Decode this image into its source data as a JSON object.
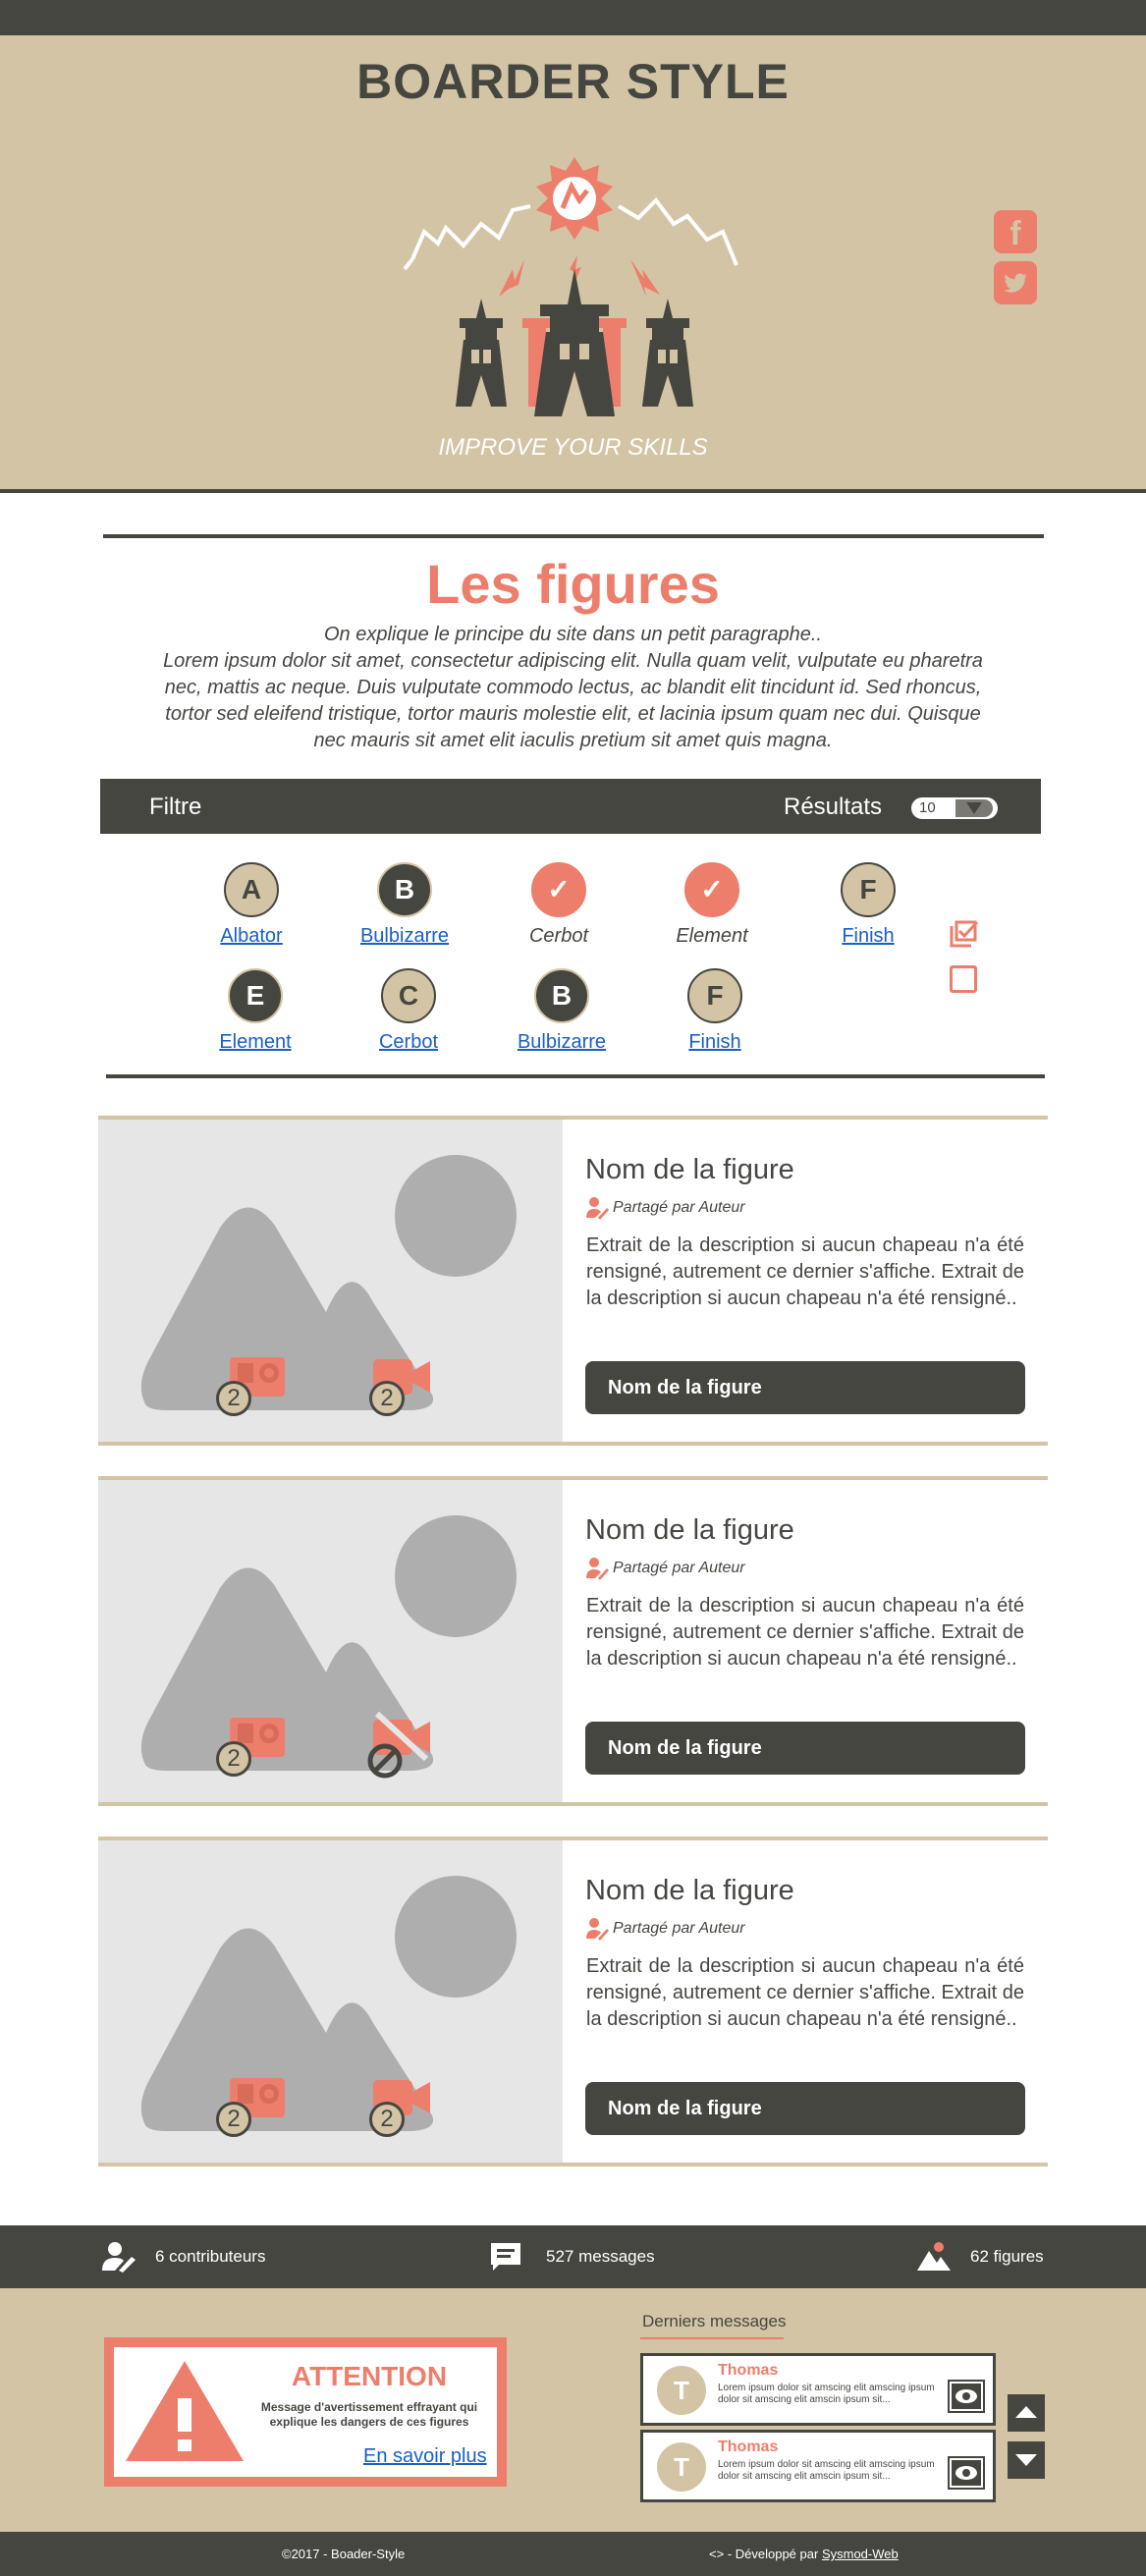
{
  "site": {
    "title": "BOARDER STYLE",
    "tagline": "IMPROVE YOUR SKILLS",
    "social": [
      {
        "label": "f",
        "icon": "facebook-icon"
      },
      {
        "label": "🐦",
        "icon": "twitter-icon"
      }
    ]
  },
  "intro": {
    "title": "Les figures",
    "lead": "On explique le principe du site dans un petit paragraphe..",
    "body": "Lorem ipsum dolor sit amet, consectetur adipiscing elit. Nulla quam velit, vulputate eu pharetra nec, mattis ac neque. Duis vulputate commodo lectus, ac blandit elit tincidunt id. Sed rhoncus, tortor sed eleifend tristique, tortor mauris molestie elit, et lacinia ipsum quam nec dui. Quisque nec mauris sit amet elit iaculis pretium sit amet quis magna."
  },
  "filter": {
    "label": "Filtre",
    "results_label": "Résultats",
    "results_value": "10",
    "chips_row1": [
      {
        "letter": "A",
        "label": "Albator",
        "style": "beige",
        "link": true
      },
      {
        "letter": "B",
        "label": "Bulbizarre",
        "style": "dark",
        "link": true
      },
      {
        "letter": "✓",
        "label": "Cerbot",
        "style": "check",
        "link": false
      },
      {
        "letter": "✓",
        "label": "Element",
        "style": "check",
        "link": false
      },
      {
        "letter": "F",
        "label": "Finish",
        "style": "beige",
        "link": true
      }
    ],
    "chips_row2": [
      {
        "letter": "E",
        "label": "Element",
        "style": "dark",
        "link": true
      },
      {
        "letter": "C",
        "label": "Cerbot",
        "style": "beige",
        "link": true
      },
      {
        "letter": "B",
        "label": "Bulbizarre",
        "style": "dark",
        "link": true
      },
      {
        "letter": "F",
        "label": "Finish",
        "style": "beige",
        "link": true
      }
    ]
  },
  "cards": [
    {
      "name": "Nom de la figure",
      "author": "Partagé par Auteur",
      "desc": "Extrait de la description si aucun chapeau n'a été rensigné, autrement ce dernier s'affiche. Extrait de la description si aucun chapeau n'a été rensigné..",
      "button": "Nom de la figure",
      "photo_count": "2",
      "video_count": "2",
      "video_available": true
    },
    {
      "name": "Nom de la figure",
      "author": "Partagé par Auteur",
      "desc": "Extrait de la description si aucun chapeau n'a été rensigné, autrement ce dernier s'affiche. Extrait de la description si aucun chapeau n'a été rensigné..",
      "button": "Nom de la figure",
      "photo_count": "2",
      "video_count": "",
      "video_available": false
    },
    {
      "name": "Nom de la figure",
      "author": "Partagé par Auteur",
      "desc": "Extrait de la description si aucun chapeau n'a été rensigné, autrement ce dernier s'affiche. Extrait de la description si aucun chapeau n'a été rensigné..",
      "button": "Nom de la figure",
      "photo_count": "2",
      "video_count": "2",
      "video_available": true
    }
  ],
  "stats": {
    "contributors": "6 contributeurs",
    "messages": "527 messages",
    "figures": "62 figures"
  },
  "alert": {
    "title": "ATTENTION",
    "text": "Message d'avertissement effrayant qui explique les dangers de ces figures",
    "link": "En savoir plus"
  },
  "messages": {
    "title": "Derniers messages",
    "items": [
      {
        "initial": "T",
        "name": "Thomas",
        "text": "Lorem ipsum dolor sit amscing elit amscing ipsum dolor sit amscing elit amscin ipsum sit..."
      },
      {
        "initial": "T",
        "name": "Thomas",
        "text": "Lorem ipsum dolor sit amscing elit amscing ipsum dolor sit amscing elit amscin ipsum sit..."
      }
    ]
  },
  "footer": {
    "copyright": "©2017 - Boader-Style",
    "dev_prefix": "- Développé par",
    "dev_name": "Sysmod-Web",
    "dev_icon": "code-icon"
  },
  "colors": {
    "dark": "#464641",
    "beige": "#d3c4a5",
    "accent": "#ec7e6b",
    "link": "#1a5fc4",
    "placeholder": "#e6e6e6"
  }
}
